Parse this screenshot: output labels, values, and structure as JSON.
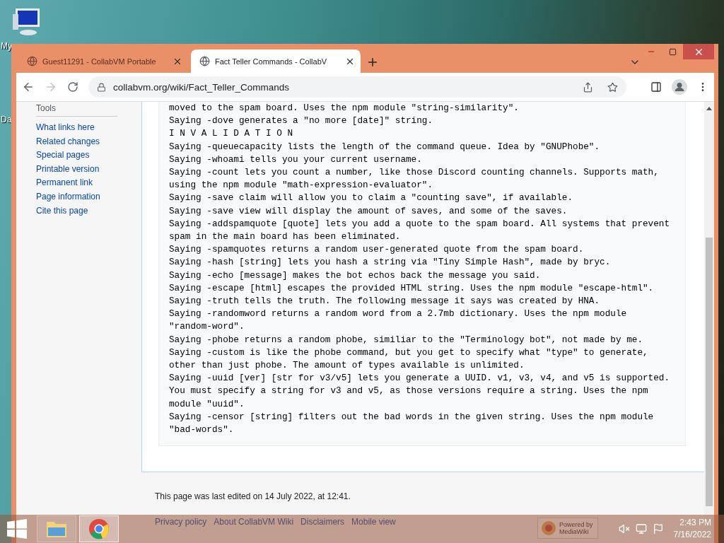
{
  "desktop": {
    "icons": [
      {
        "label": "My"
      },
      {
        "label": "Da"
      }
    ]
  },
  "browser": {
    "tabs": [
      {
        "title": "Guest11291 - CollabVM Portable",
        "selected": false
      },
      {
        "title": "Fact Teller Commands - CollabV",
        "selected": true
      }
    ],
    "address": "collabvm.org/wiki/Fact_Teller_Commands"
  },
  "sidebar": {
    "heading": "Tools",
    "links": [
      "What links here",
      "Related changes",
      "Special pages",
      "Printable version",
      "Permanent link",
      "Page information",
      "Cite this page"
    ]
  },
  "content": {
    "lines": [
      "moved to the spam board. Uses the npm module \"string-similarity\".",
      "Saying -dove generates a \"no more [date]\" string.",
      "I N V A L I D A T I O N",
      "Saying -queuecapacity lists the length of the command queue. Idea by \"GNUPhobe\".",
      "Saying -whoami tells you your current username.",
      "Saying -count lets you count a number, like those Discord counting channels. Supports math,",
      "using the npm module \"math-expression-evaluator\".",
      "Saying -save claim will allow you to claim a \"counting save\", if available.",
      "Saying -save view will display the amount of saves, and some of the saves.",
      "Saying -addspamquote [quote] lets you add a quote to the spam board. All systems that prevent",
      "spam in the main board has been eliminated.",
      "Saying -spamquotes returns a random user-generated quote from the spam board.",
      "Saying -hash [string] lets you hash a string via \"Tiny Simple Hash\", made by bryc.",
      "Saying -echo [message] makes the bot echos back the message you said.",
      "Saying -escape [html] escapes the provided HTML string. Uses the npm module \"escape-html\".",
      "Saying -truth tells the truth. The following message it says was created by HNA.",
      "Saying -randomword returns a random word from a 2.7mb dictionary. Uses the npm module",
      "\"random-word\".",
      "Saying -phobe returns a random phobe, similiar to the \"Terminology bot\", not made by me.",
      "Saying -custom is like the phobe command, but you get to specify what \"type\" to generate,",
      "other than just phobe. The amount of types available is unlimited.",
      "Saying -uuid [ver] [str for v3/v5] lets you generate a UUID. v1, v3, v4, and v5 is supported.",
      "You must specify a string for v3 and v5, as those versions require a string. Uses the npm",
      "module \"uuid\".",
      "Saying -censor [string] filters out the bad words in the given string. Uses the npm module",
      "\"bad-words\"."
    ]
  },
  "footer": {
    "last_edited": "This page was last edited on 14 July 2022, at 12:41.",
    "links": [
      "Privacy policy",
      "About CollabVM Wiki",
      "Disclaimers",
      "Mobile view"
    ],
    "powered_by": "Powered by",
    "powered_name": "MediaWiki"
  },
  "taskbar": {
    "apps": [
      {
        "kind": "explorer",
        "selected": false
      },
      {
        "kind": "chrome",
        "selected": true
      }
    ],
    "time": "2:43 PM",
    "date": "7/16/2022"
  }
}
